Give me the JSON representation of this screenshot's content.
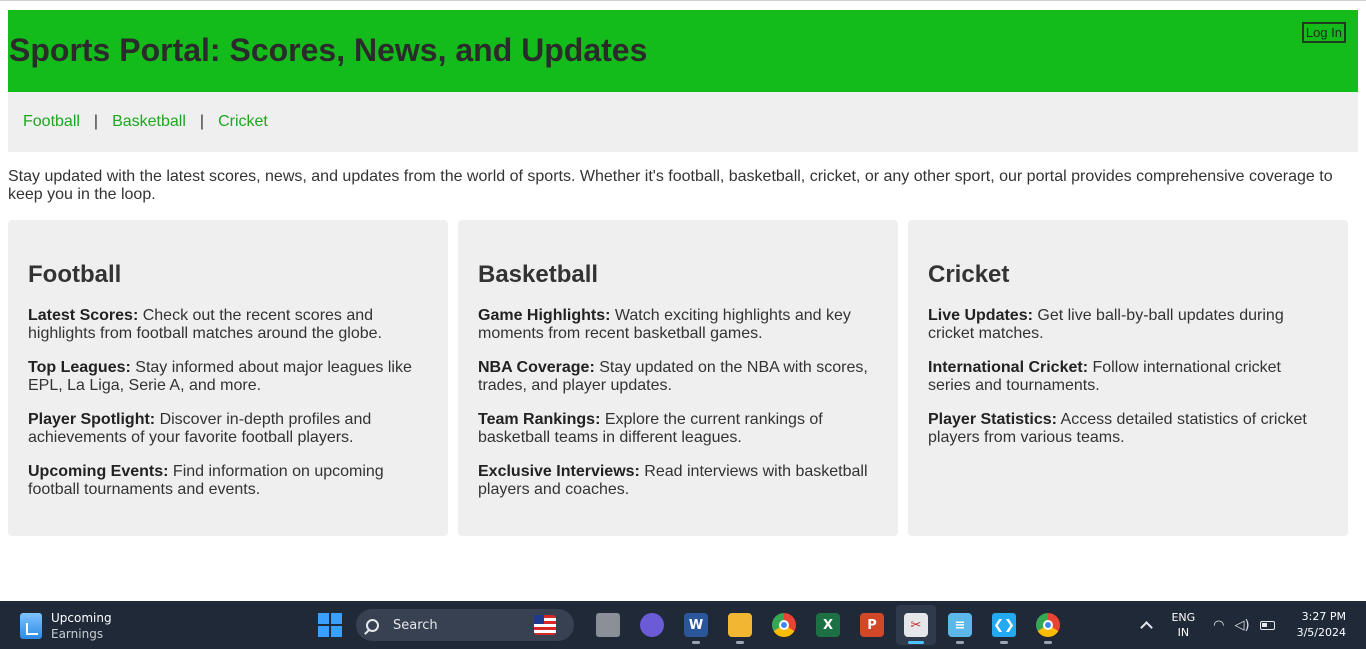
{
  "header": {
    "title": "Sports Portal: Scores, News, and Updates",
    "login_label": "Log In"
  },
  "nav": {
    "items": [
      "Football",
      "Basketball",
      "Cricket"
    ],
    "separator": "|"
  },
  "intro": "Stay updated with the latest scores, news, and updates from the world of sports. Whether it's football, basketball, cricket, or any other sport, our portal provides comprehensive coverage to keep you in the loop.",
  "cards": [
    {
      "title": "Football",
      "items": [
        {
          "label": "Latest Scores:",
          "text": " Check out the recent scores and highlights from football matches around the globe."
        },
        {
          "label": "Top Leagues:",
          "text": " Stay informed about major leagues like EPL, La Liga, Serie A, and more."
        },
        {
          "label": "Player Spotlight:",
          "text": " Discover in-depth profiles and achievements of your favorite football players."
        },
        {
          "label": "Upcoming Events:",
          "text": " Find information on upcoming football tournaments and events."
        }
      ]
    },
    {
      "title": "Basketball",
      "items": [
        {
          "label": "Game Highlights:",
          "text": " Watch exciting highlights and key moments from recent basketball games."
        },
        {
          "label": "NBA Coverage:",
          "text": " Stay updated on the NBA with scores, trades, and player updates."
        },
        {
          "label": "Team Rankings:",
          "text": " Explore the current rankings of basketball teams in different leagues."
        },
        {
          "label": "Exclusive Interviews:",
          "text": " Read interviews with basketball players and coaches."
        }
      ]
    },
    {
      "title": "Cricket",
      "items": [
        {
          "label": "Live Updates:",
          "text": " Get live ball-by-ball updates during cricket matches."
        },
        {
          "label": "International Cricket:",
          "text": " Follow international cricket series and tournaments."
        },
        {
          "label": "Player Statistics:",
          "text": " Access detailed statistics of cricket players from various teams."
        }
      ]
    }
  ],
  "taskbar": {
    "weather_title": "Upcoming",
    "weather_sub": "Earnings",
    "search_label": "Search",
    "apps": [
      {
        "name": "task-view",
        "glyph": ""
      },
      {
        "name": "teams",
        "glyph": ""
      },
      {
        "name": "word",
        "glyph": "W"
      },
      {
        "name": "file-explorer",
        "glyph": ""
      },
      {
        "name": "chrome",
        "glyph": ""
      },
      {
        "name": "excel",
        "glyph": "X"
      },
      {
        "name": "powerpoint",
        "glyph": "P"
      },
      {
        "name": "snipping-tool",
        "glyph": "✂"
      },
      {
        "name": "notepad",
        "glyph": "≡"
      },
      {
        "name": "vscode",
        "glyph": "❮❯"
      },
      {
        "name": "chrome-2",
        "glyph": ""
      }
    ],
    "lang_top": "ENG",
    "lang_bottom": "IN",
    "time": "3:27 PM",
    "date": "3/5/2024"
  },
  "colors": {
    "header_bg": "#13bc1a",
    "nav_link": "#1fa61f",
    "card_bg": "#efefef",
    "taskbar_bg": "#1f2937"
  }
}
